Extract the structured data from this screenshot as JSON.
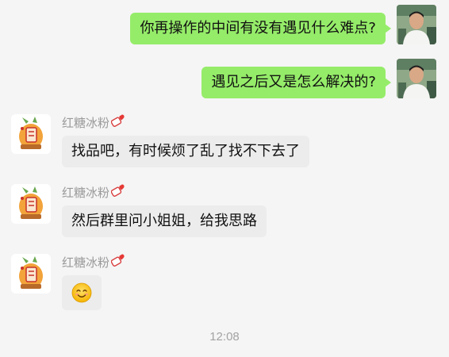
{
  "messages": [
    {
      "direction": "out",
      "text": "你再操作的中间有没有遇见什么难点?"
    },
    {
      "direction": "out",
      "text": "遇见之后又是怎么解决的?"
    },
    {
      "direction": "in",
      "sender": "红糖冰粉",
      "text": "找品吧，有时候烦了乱了找不下去了"
    },
    {
      "direction": "in",
      "sender": "红糖冰粉",
      "text": "然后群里问小姐姐，给我思路"
    },
    {
      "direction": "in",
      "sender": "红糖冰粉",
      "emoji": "smiling-face-emoji"
    }
  ],
  "timestamp": "12:08",
  "colors": {
    "outgoing_bubble": "#95ec69",
    "incoming_bubble": "#ececec",
    "background": "#f5f5f5",
    "sender_name": "#9a9a9a"
  }
}
